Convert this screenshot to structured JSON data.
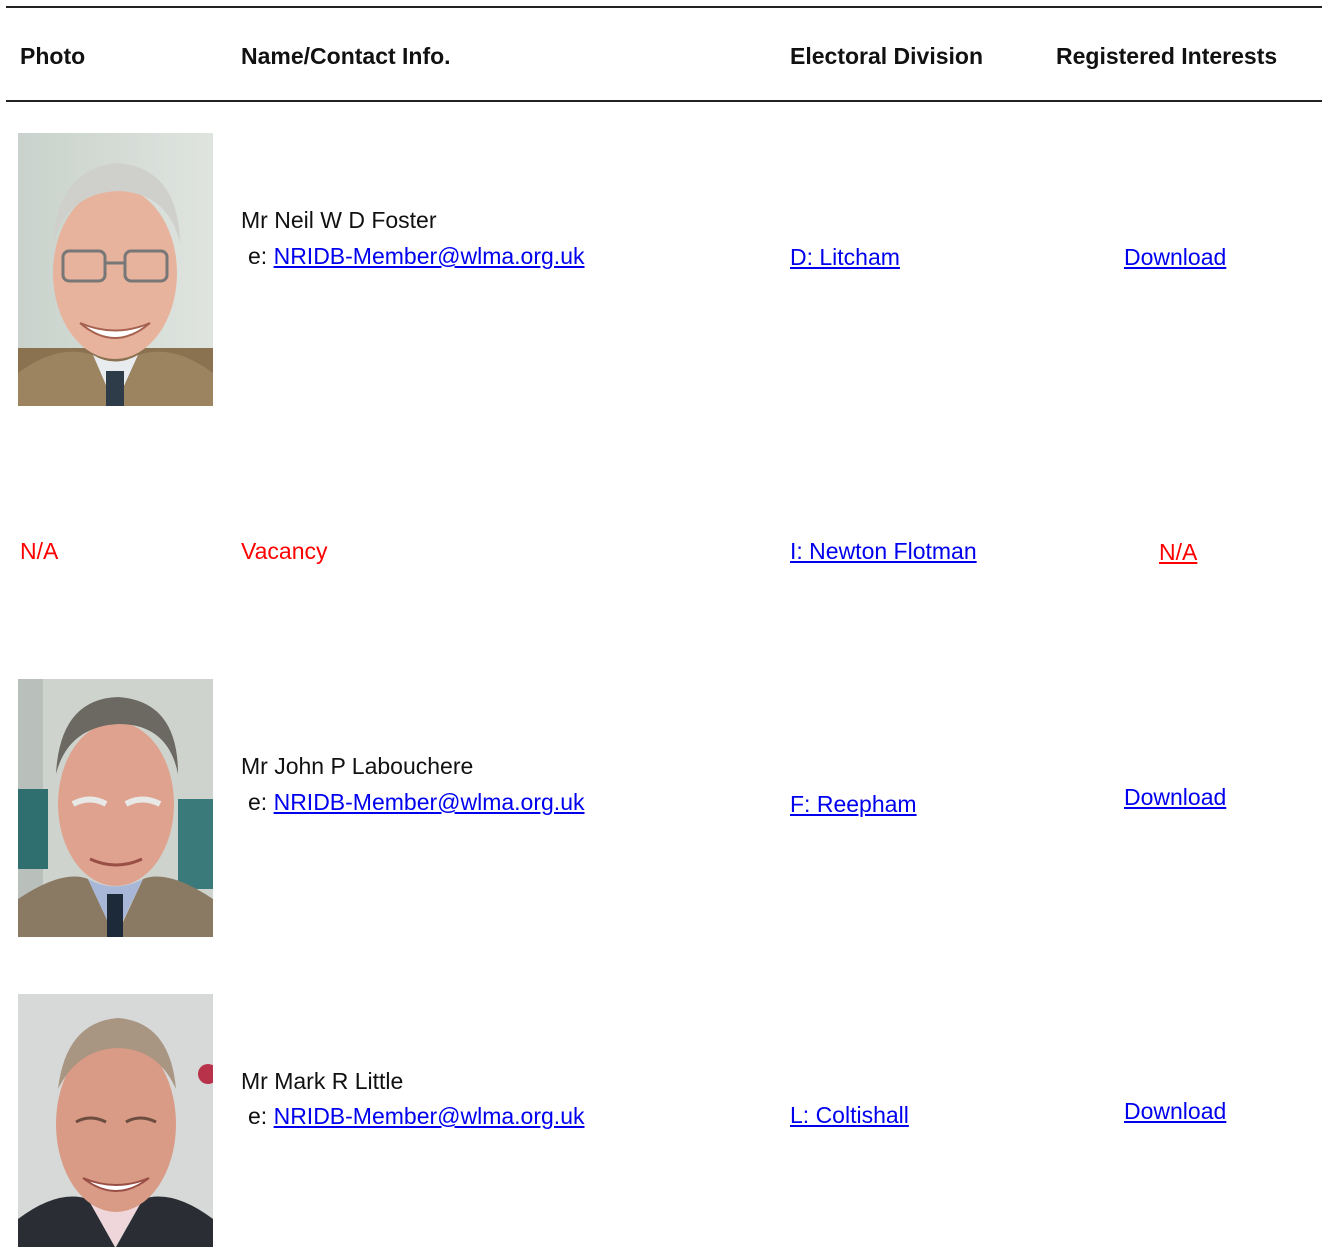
{
  "header": {
    "photo": "Photo",
    "name_contact": "Name/Contact Info.",
    "electoral_division": "Electoral Division",
    "registered_interests": "Registered Interests"
  },
  "members": [
    {
      "name": "Mr Neil W D Foster",
      "email_prefix": "e:",
      "email": "NRIDB-Member@wlma.org.uk",
      "division": "D: Litcham",
      "interests": "Download"
    },
    {
      "photo": "N/A",
      "name": "Vacancy",
      "division": "I: Newton Flotman",
      "interests": "N/A"
    },
    {
      "name": "Mr John P Labouchere",
      "email_prefix": "e:",
      "email": "NRIDB-Member@wlma.org.uk",
      "division": "F: Reepham",
      "interests": "Download"
    },
    {
      "name": "Mr Mark R Little",
      "email_prefix": "e:",
      "email": "NRIDB-Member@wlma.org.uk",
      "division": "L: Coltishall",
      "interests": "Download"
    }
  ],
  "colors": {
    "link": "#0000ee",
    "vacancy": "#ff0000",
    "text": "#111111",
    "rule": "#222222"
  }
}
